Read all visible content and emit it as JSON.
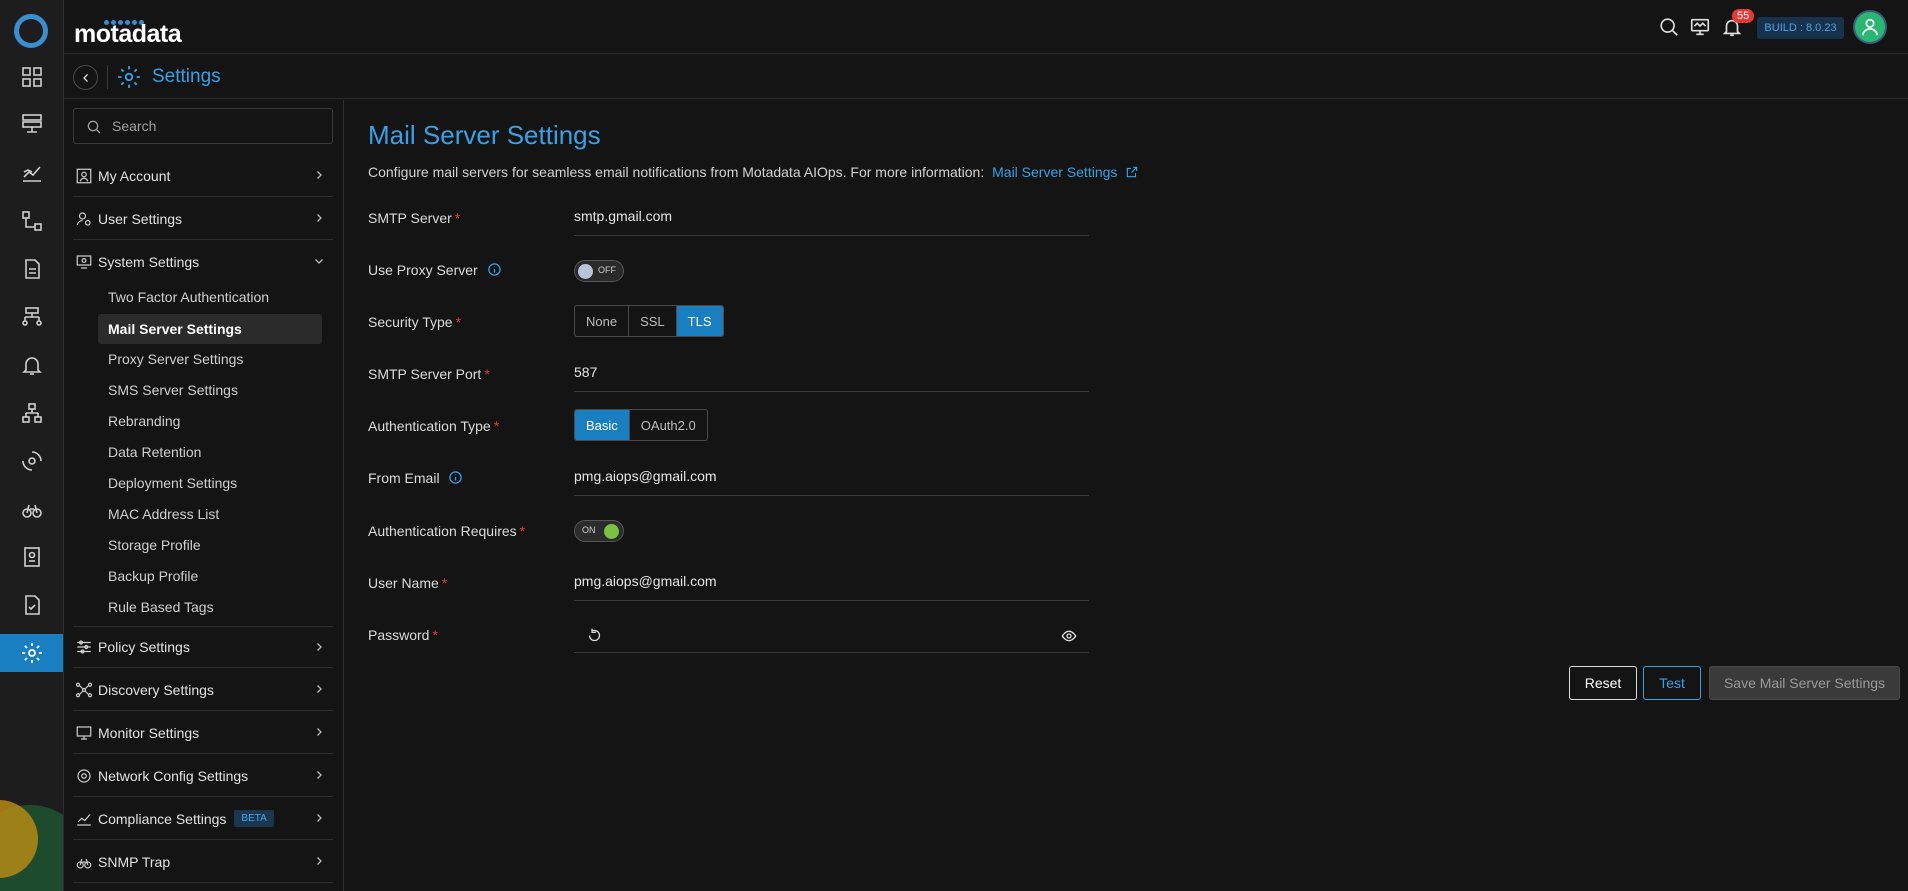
{
  "app": {
    "brand": "motadata",
    "build": "BUILD : 8.0.23",
    "notification_count": "55"
  },
  "subbar": {
    "title": "Settings"
  },
  "sidebar": {
    "search_placeholder": "Search",
    "sections": [
      {
        "label": "My Account",
        "icon": "account-icon"
      },
      {
        "label": "User Settings",
        "icon": "user-settings-icon"
      },
      {
        "label": "System Settings",
        "icon": "system-settings-icon",
        "expanded": true
      },
      {
        "label": "Policy Settings",
        "icon": "sliders-icon"
      },
      {
        "label": "Discovery Settings",
        "icon": "discovery-icon"
      },
      {
        "label": "Monitor Settings",
        "icon": "monitor-icon"
      },
      {
        "label": "Network Config Settings",
        "icon": "network-config-icon"
      },
      {
        "label": "Compliance Settings",
        "icon": "compliance-icon",
        "badge": "BETA"
      },
      {
        "label": "SNMP Trap",
        "icon": "binoculars-icon"
      }
    ],
    "system_items": [
      "Two Factor Authentication",
      "Mail Server Settings",
      "Proxy Server Settings",
      "SMS Server Settings",
      "Rebranding",
      "Data Retention",
      "Deployment Settings",
      "MAC Address List",
      "Storage Profile",
      "Backup Profile",
      "Rule Based Tags"
    ],
    "active_item": "Mail Server Settings"
  },
  "main": {
    "title": "Mail Server Settings",
    "description": "Configure mail servers for seamless email notifications from Motadata AIOps. For more information:",
    "description_link": "Mail Server Settings",
    "smtp_server": {
      "label": "SMTP Server",
      "value": "smtp.gmail.com"
    },
    "use_proxy": {
      "label": "Use Proxy Server",
      "state": "OFF"
    },
    "security_type": {
      "label": "Security Type",
      "options": [
        "None",
        "SSL",
        "TLS"
      ],
      "selected": "TLS"
    },
    "smtp_port": {
      "label": "SMTP Server Port",
      "value": "587"
    },
    "auth_type": {
      "label": "Authentication Type",
      "options": [
        "Basic",
        "OAuth2.0"
      ],
      "selected": "Basic"
    },
    "from_email": {
      "label": "From Email",
      "value": "pmg.aiops@gmail.com"
    },
    "auth_requires": {
      "label": "Authentication Requires",
      "state": "ON"
    },
    "user_name": {
      "label": "User Name",
      "value": "pmg.aiops@gmail.com"
    },
    "password": {
      "label": "Password",
      "value": ""
    },
    "buttons": {
      "reset": "Reset",
      "test": "Test",
      "save": "Save Mail Server Settings"
    }
  },
  "colors": {
    "accent": "#1a7fc1",
    "link": "#3aa0e6",
    "required": "#e53935",
    "toggle_on": "#7cc242"
  }
}
